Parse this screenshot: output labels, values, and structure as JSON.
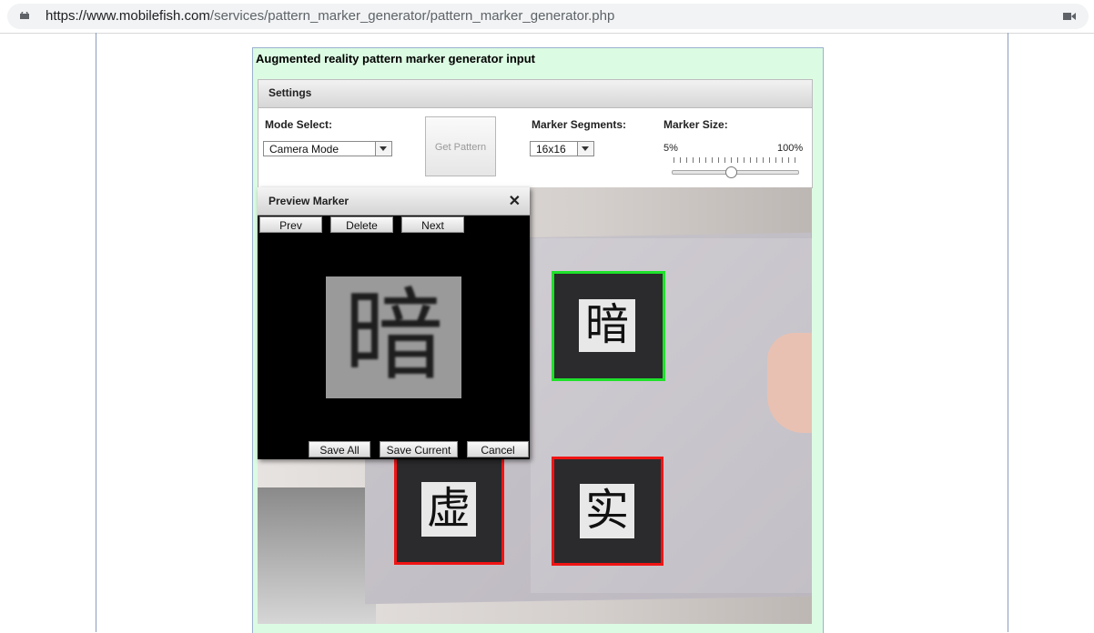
{
  "browser": {
    "url_host": "https://www.mobilefish.com",
    "url_path": "/services/pattern_marker_generator/pattern_marker_generator.php"
  },
  "page": {
    "title": "Augmented reality pattern marker generator input"
  },
  "settings": {
    "title": "Settings",
    "mode_label": "Mode Select:",
    "mode_value": "Camera Mode",
    "get_pattern_label": "Get Pattern",
    "segments_label": "Marker Segments:",
    "segments_value": "16x16",
    "size_label": "Marker Size:",
    "size_min": "5%",
    "size_max": "100%",
    "size_level_fraction": 0.47
  },
  "camera": {
    "markers": [
      {
        "char": "暗",
        "state": "detected"
      },
      {
        "char": "虚",
        "state": "candidate"
      },
      {
        "char": "实",
        "state": "candidate"
      }
    ],
    "colors": {
      "detected": "#1fe12b",
      "candidate": "#f01414"
    }
  },
  "preview": {
    "title": "Preview Marker",
    "close_glyph": "✕",
    "prev_label": "Prev",
    "delete_label": "Delete",
    "next_label": "Next",
    "marker_char": "暗",
    "save_all_label": "Save All",
    "save_current_label": "Save Current",
    "cancel_label": "Cancel"
  }
}
